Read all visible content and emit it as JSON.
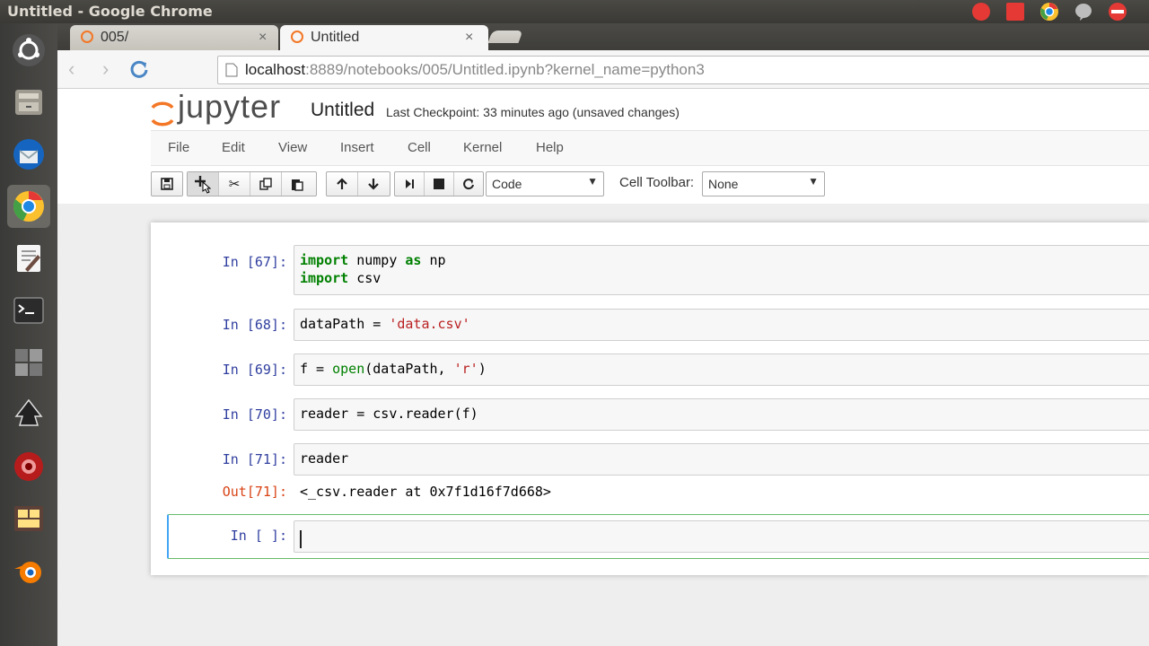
{
  "window": {
    "title": "Untitled - Google Chrome"
  },
  "tabs": [
    {
      "label": "005/",
      "close": "×"
    },
    {
      "label": "Untitled",
      "close": "×"
    }
  ],
  "address": {
    "host": "localhost",
    "rest": ":8889/notebooks/005/Untitled.ipynb?kernel_name=python3"
  },
  "jupyter": {
    "logo_text": "jupyter",
    "notebook_name": "Untitled",
    "checkpoint": "Last Checkpoint: 33 minutes ago (unsaved changes)"
  },
  "menu": [
    "File",
    "Edit",
    "View",
    "Insert",
    "Cell",
    "Kernel",
    "Help"
  ],
  "toolbar": {
    "cell_type": "Code",
    "cell_toolbar_label": "Cell Toolbar:",
    "cell_toolbar_value": "None"
  },
  "cells": [
    {
      "prompt": "In [67]:"
    },
    {
      "prompt": "In [68]:"
    },
    {
      "prompt": "In [69]:"
    },
    {
      "prompt": "In [70]:"
    },
    {
      "prompt": "In [71]:",
      "code": "reader",
      "out_prompt": "Out[71]:",
      "output": "<_csv.reader at 0x7f1d16f7d668>"
    },
    {
      "prompt": "In [ ]:"
    }
  ],
  "code_tokens": {
    "c67_l1_kw1": "import",
    "c67_l1_t1": " numpy ",
    "c67_l1_kw2": "as",
    "c67_l1_t2": " np",
    "c67_l2_kw": "import",
    "c67_l2_t": " csv",
    "c68_t": "dataPath = ",
    "c68_str": "'data.csv'",
    "c69_t1": "f = ",
    "c69_bi": "open",
    "c69_t2": "(dataPath, ",
    "c69_str": "'r'",
    "c69_t3": ")",
    "c70_t": "reader = csv.reader(f)"
  },
  "colors": {
    "prompt_in": "#303f9f",
    "prompt_out": "#d84315",
    "keyword": "#008000",
    "string": "#ba2121",
    "selected_border": "#66bb6a"
  }
}
